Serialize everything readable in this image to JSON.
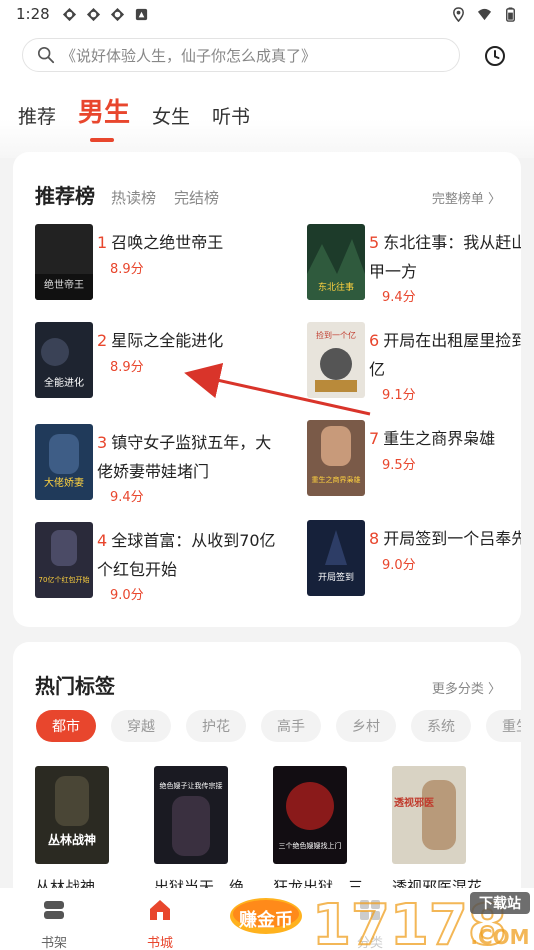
{
  "status": {
    "time": "1:28",
    "icons": [
      "app-icon",
      "app-icon",
      "app-icon",
      "notification-icon"
    ],
    "right_icons": [
      "location-icon",
      "wifi-icon",
      "battery-icon"
    ]
  },
  "search": {
    "placeholder": "《说好体验人生，仙子你怎么成真了》"
  },
  "tabs": [
    {
      "label": "推荐",
      "active": false
    },
    {
      "label": "男生",
      "active": true
    },
    {
      "label": "女生",
      "active": false
    },
    {
      "label": "听书",
      "active": false
    }
  ],
  "ranking": {
    "title": "推荐榜",
    "sub_tabs": [
      "热读榜",
      "完结榜"
    ],
    "more": "完整榜单 〉",
    "items": [
      {
        "rank": "1",
        "title": "召唤之绝世帝王",
        "score": "8.9分",
        "cover_text": "绝世帝王"
      },
      {
        "rank": "2",
        "title": "星际之全能进化",
        "score": "8.9分",
        "cover_text": "全能进化"
      },
      {
        "rank": "3",
        "title": "镇守女子监狱五年，大佬娇妻带娃堵门",
        "score": "9.4分",
        "cover_text": "大佬娇妻"
      },
      {
        "rank": "4",
        "title": "全球首富：从收到70亿个红包开始",
        "score": "9.0分",
        "cover_text": "70亿个红包开始"
      },
      {
        "rank": "5",
        "title": "东北往事：我从赶山富甲一方",
        "score": "9.4分",
        "cover_text": "东北往事"
      },
      {
        "rank": "6",
        "title": "开局在出租屋里捡到一亿",
        "score": "9.1分",
        "cover_text": "捡到一个亿"
      },
      {
        "rank": "7",
        "title": "重生之商界枭雄",
        "score": "9.5分",
        "cover_text": "重生之商界枭雄"
      },
      {
        "rank": "8",
        "title": "开局签到一个吕奉先",
        "score": "9.0分",
        "cover_text": "开局签到"
      }
    ]
  },
  "hot_tags": {
    "title": "热门标签",
    "more": "更多分类 〉",
    "tags": [
      "都市",
      "穿越",
      "护花",
      "高手",
      "乡村",
      "系统",
      "重生"
    ],
    "books": [
      {
        "title": "丛林战神",
        "cover_text": "丛林战神"
      },
      {
        "title": "出狱当天，绝",
        "cover_text": "绝色嫂子让我传宗接"
      },
      {
        "title": "狂龙出狱，三",
        "cover_text": "三个绝色嫂嫂找上门"
      },
      {
        "title": "透视邪医混花",
        "cover_text": "透视邪医"
      }
    ]
  },
  "bottom_nav": [
    {
      "label": "书架",
      "icon": "bookshelf-icon",
      "active": false
    },
    {
      "label": "书城",
      "icon": "home-icon",
      "active": true
    },
    {
      "label": "赚金币",
      "icon": "coin-icon",
      "active": false
    },
    {
      "label": "分类",
      "icon": "category-icon",
      "active": false
    }
  ],
  "promo": {
    "badge": "赚金币",
    "label": "赚金币"
  },
  "watermark": {
    "text": "17178",
    "tag": "下载站",
    "domain": ".COM"
  },
  "colors": {
    "accent": "#e8462d",
    "arrow": "#d9342a"
  }
}
